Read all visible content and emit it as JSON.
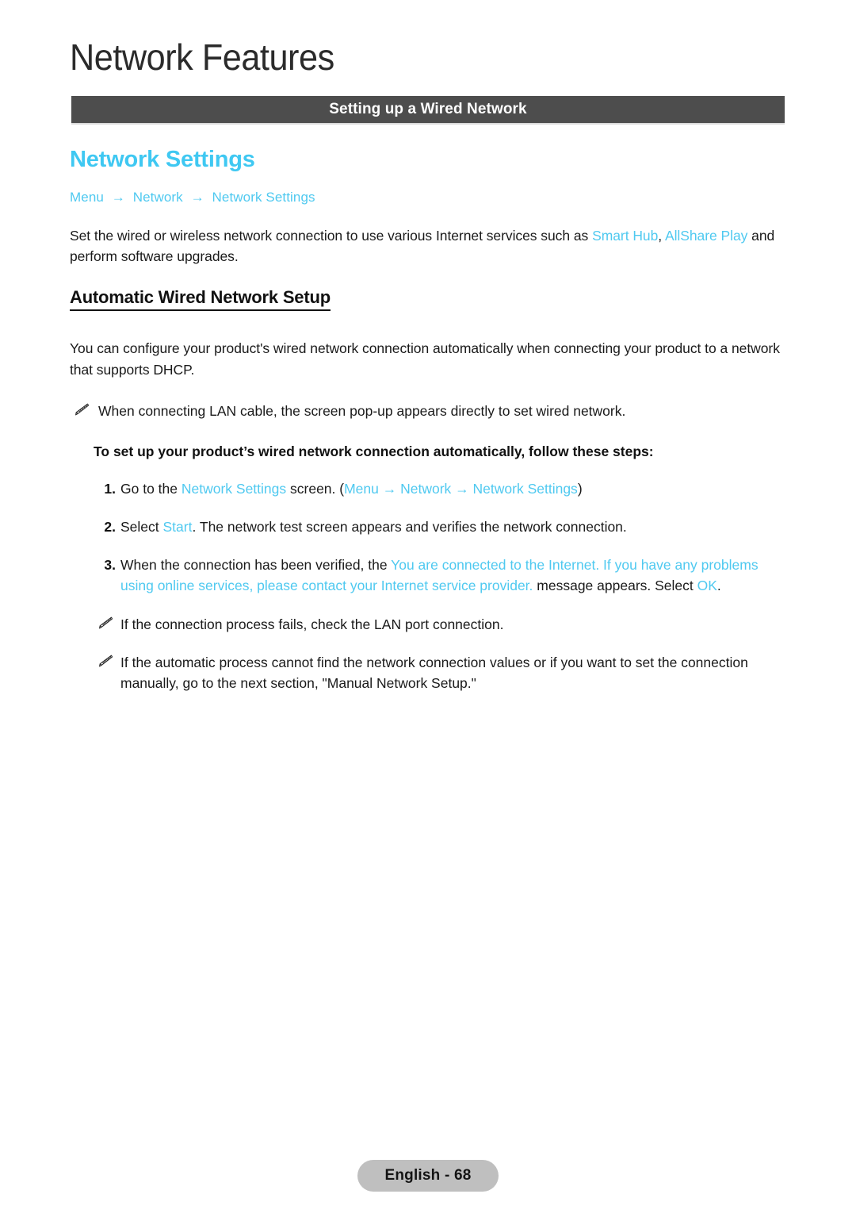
{
  "chapter": {
    "title": "Network Features"
  },
  "banner": {
    "label": "Setting up a Wired Network"
  },
  "topic": {
    "heading": "Network Settings"
  },
  "breadcrumb": {
    "items": [
      "Menu",
      "Network",
      "Network Settings"
    ],
    "separator": "→"
  },
  "intro": {
    "p1_a": "Set the wired or wireless network connection to use various Internet services such as ",
    "p1_link1": "Smart Hub",
    "p1_b": ", ",
    "p1_link2": "AllShare Play",
    "p1_c": " and perform software upgrades."
  },
  "subsection": {
    "heading": "Automatic Wired Network Setup",
    "paragraph": "You can configure your product's wired network connection automatically when connecting your product to a network that supports DHCP.",
    "note1": "When connecting LAN cable, the screen pop-up appears directly to set wired network.",
    "lead_in": "To set up your product’s wired network connection automatically, follow these steps:"
  },
  "steps": [
    {
      "number": "1.",
      "a": "Go to the ",
      "link1": "Network Settings",
      "b": " screen. (",
      "link2": "Menu",
      "c": " → ",
      "link3": "Network",
      "d": " → ",
      "link4": "Network Settings",
      "e": ")"
    },
    {
      "number": "2.",
      "a": "Select ",
      "link1": "Start",
      "b": ". The network test screen appears and verifies the network connection."
    },
    {
      "number": "3.",
      "a": "When the connection has been verified, the ",
      "link1": "You are connected to the Internet. If you have any problems using online services, please contact your Internet service provider.",
      "b": " message appears. Select ",
      "link2": "OK",
      "c": "."
    }
  ],
  "tail_notes": [
    "If the connection process fails, check the LAN port connection.",
    "If the automatic process cannot find the network connection values or if you want to set the connection manually, go to the next section, \"Manual Network Setup.\""
  ],
  "icons": {
    "note_bullet": "pencil-icon"
  },
  "footer": {
    "label": "English - 68"
  },
  "colors": {
    "accent_cyan": "#4fc9f0",
    "banner_bg": "#4d4d4d",
    "footer_badge_bg": "#bfbfbf",
    "body_text": "#1a1a1a"
  }
}
